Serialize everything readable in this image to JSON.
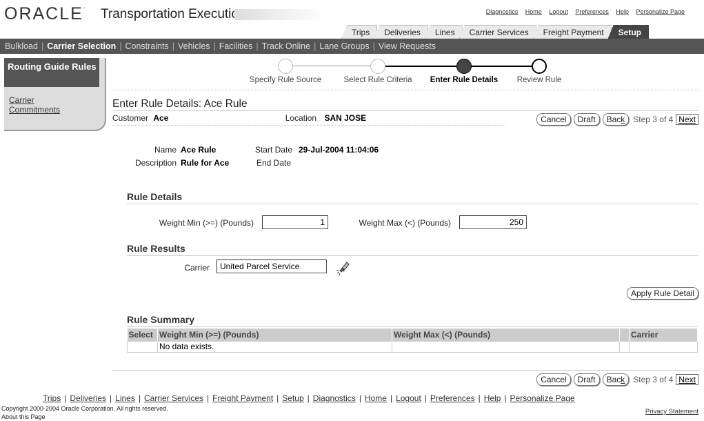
{
  "brand": {
    "logo": "ORACLE",
    "app_title": "Transportation Execution"
  },
  "global_links": [
    "Diagnostics",
    "Home",
    "Logout",
    "Preferences",
    "Help",
    "Personalize Page"
  ],
  "tabs": [
    {
      "label": "Trips",
      "active": false
    },
    {
      "label": "Deliveries",
      "active": false
    },
    {
      "label": "Lines",
      "active": false
    },
    {
      "label": "Carrier Services",
      "active": false
    },
    {
      "label": "Freight Payment",
      "active": false
    },
    {
      "label": "Setup",
      "active": true
    }
  ],
  "subnav": [
    {
      "label": "Bulkload",
      "selected": false
    },
    {
      "label": "Carrier Selection",
      "selected": true
    },
    {
      "label": "Constraints",
      "selected": false
    },
    {
      "label": "Vehicles",
      "selected": false
    },
    {
      "label": "Facilities",
      "selected": false
    },
    {
      "label": "Track Online",
      "selected": false
    },
    {
      "label": "Lane Groups",
      "selected": false
    },
    {
      "label": "View Requests",
      "selected": false
    }
  ],
  "sidenav": {
    "routing": "Routing Guide Rules",
    "carrier": "Carrier Commitments"
  },
  "train": {
    "steps": [
      "Specify Rule Source",
      "Select Rule Criteria",
      "Enter Rule Details",
      "Review Rule"
    ],
    "current": 2
  },
  "page_title": "Enter Rule Details: Ace Rule",
  "context": {
    "customer_label": "Customer",
    "customer_value": "Ace",
    "location_label": "Location",
    "location_value": "SAN JOSE"
  },
  "actions": {
    "cancel": "Cancel",
    "draft": "Draft",
    "back": "Back",
    "step_text": "Step 3 of 4",
    "next": "Next"
  },
  "rule_info": {
    "name_label": "Name",
    "name_value": "Ace Rule",
    "description_label": "Description",
    "description_value": "Rule for Ace",
    "start_label": "Start Date",
    "start_value": "29-Jul-2004 11:04:06",
    "end_label": "End Date",
    "end_value": ""
  },
  "rule_details": {
    "heading": "Rule Details",
    "weight_min_label": "Weight Min (>=) (Pounds)",
    "weight_min_value": "1",
    "weight_max_label": "Weight Max (<) (Pounds)",
    "weight_max_value": "250"
  },
  "rule_results": {
    "heading": "Rule Results",
    "carrier_label": "Carrier",
    "carrier_value": "United Parcel Service",
    "apply_button": "Apply Rule Detail"
  },
  "summary": {
    "heading": "Rule Summary",
    "columns": [
      "Select",
      "Weight Min (>=) (Pounds)",
      "Weight Max (<) (Pounds)",
      "Carrier"
    ],
    "empty": "No data exists."
  },
  "footer": {
    "links": [
      "Trips",
      "Deliveries",
      "Lines",
      "Carrier Services",
      "Freight Payment",
      "Setup",
      "Diagnostics",
      "Home",
      "Logout",
      "Preferences",
      "Help",
      "Personalize Page"
    ],
    "copyright": "Copyright 2000-2004 Oracle Corporation. All rights reserved.",
    "about": "About this Page",
    "privacy": "Privacy Statement"
  }
}
